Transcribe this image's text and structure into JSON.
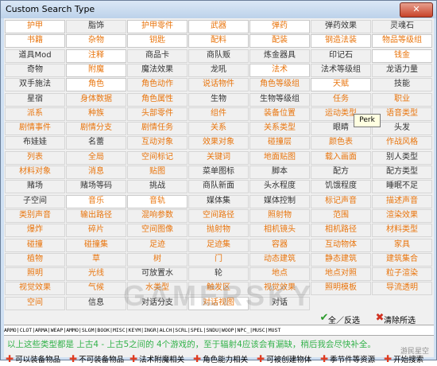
{
  "window": {
    "title": "Custom Search Type",
    "close_label": "✕"
  },
  "grid": [
    [
      {
        "t": "护甲",
        "c": "o",
        "h": 1
      },
      {
        "t": "脂饰",
        "c": "g"
      },
      {
        "t": "护甲零件",
        "c": "o",
        "h": 1
      },
      {
        "t": "武器",
        "c": "o",
        "h": 1
      },
      {
        "t": "弹药",
        "c": "o",
        "h": 1
      },
      {
        "t": "弹药效果",
        "c": "g"
      },
      {
        "t": "灵魂石",
        "c": "g"
      }
    ],
    [
      {
        "t": "书籍",
        "c": "o",
        "h": 1
      },
      {
        "t": "杂物",
        "c": "o",
        "h": 1
      },
      {
        "t": "钥匙",
        "c": "o",
        "h": 1
      },
      {
        "t": "配料",
        "c": "o",
        "h": 1
      },
      {
        "t": "配装",
        "c": "o",
        "h": 1
      },
      {
        "t": "钢造法装",
        "c": "o",
        "h": 1
      },
      {
        "t": "物品等级组",
        "c": "o",
        "h": 1
      }
    ],
    [
      {
        "t": "道具Mod",
        "c": "g"
      },
      {
        "t": "注释",
        "c": "o",
        "h": 1
      },
      {
        "t": "商品卡",
        "c": "g"
      },
      {
        "t": "商队贩",
        "c": "g"
      },
      {
        "t": "炼金器具",
        "c": "g"
      },
      {
        "t": "印记石",
        "c": "g"
      },
      {
        "t": "钱金",
        "c": "o",
        "h": 1
      }
    ],
    [
      {
        "t": "奇物",
        "c": "b"
      },
      {
        "t": "附魔",
        "c": "o",
        "h": 1
      },
      {
        "t": "魔法效果",
        "c": "g"
      },
      {
        "t": "龙吼",
        "c": "g"
      },
      {
        "t": "法术",
        "c": "o",
        "h": 1
      },
      {
        "t": "法术等级组",
        "c": "g"
      },
      {
        "t": "龙语力量",
        "c": "g"
      }
    ],
    [
      {
        "t": "双手施法",
        "c": "g"
      },
      {
        "t": "角色",
        "c": "o",
        "h": 1
      },
      {
        "t": "角色动作",
        "c": "o"
      },
      {
        "t": "说话物件",
        "c": "o"
      },
      {
        "t": "角色等级组",
        "c": "o"
      },
      {
        "t": "天赋",
        "c": "o",
        "h": 1
      },
      {
        "t": "技能",
        "c": "g"
      }
    ],
    [
      {
        "t": "星宿",
        "c": "g"
      },
      {
        "t": "身体数据",
        "c": "o"
      },
      {
        "t": "角色属性",
        "c": "o"
      },
      {
        "t": "生物",
        "c": "g"
      },
      {
        "t": "生物等级组",
        "c": "g"
      },
      {
        "t": "任务",
        "c": "o"
      },
      {
        "t": "职业",
        "c": "o"
      }
    ],
    [
      {
        "t": "派系",
        "c": "o"
      },
      {
        "t": "种族",
        "c": "o"
      },
      {
        "t": "头部零件",
        "c": "o"
      },
      {
        "t": "组件",
        "c": "o"
      },
      {
        "t": "装备位置",
        "c": "o"
      },
      {
        "t": "运动类型",
        "c": "o"
      },
      {
        "t": "语音类型",
        "c": "o"
      }
    ],
    [
      {
        "t": "剧情事件",
        "c": "o"
      },
      {
        "t": "剧情分支",
        "c": "o"
      },
      {
        "t": "剧情任务",
        "c": "o"
      },
      {
        "t": "关系",
        "c": "o"
      },
      {
        "t": "关系类型",
        "c": "o"
      },
      {
        "t": "眼睛",
        "c": "g"
      },
      {
        "t": "头发",
        "c": "g"
      }
    ],
    [
      {
        "t": "布娃娃",
        "c": "g"
      },
      {
        "t": "名蕾",
        "c": "g"
      },
      {
        "t": "互动对象",
        "c": "o"
      },
      {
        "t": "效果对象",
        "c": "o"
      },
      {
        "t": "碰撞层",
        "c": "o"
      },
      {
        "t": "颜色表",
        "c": "o"
      },
      {
        "t": "作战风格",
        "c": "o"
      }
    ],
    [
      {
        "t": "列表",
        "c": "o"
      },
      {
        "t": "全局",
        "c": "o"
      },
      {
        "t": "空间标记",
        "c": "o"
      },
      {
        "t": "关键词",
        "c": "o"
      },
      {
        "t": "地面贴图",
        "c": "o"
      },
      {
        "t": "载入画面",
        "c": "o"
      },
      {
        "t": "别人类型",
        "c": "g"
      }
    ],
    [
      {
        "t": "材料对象",
        "c": "o"
      },
      {
        "t": "消息",
        "c": "o"
      },
      {
        "t": "贴图",
        "c": "o"
      },
      {
        "t": "菜单图标",
        "c": "g"
      },
      {
        "t": "脚本",
        "c": "g"
      },
      {
        "t": "配方",
        "c": "g"
      },
      {
        "t": "配方类型",
        "c": "g"
      }
    ],
    [
      {
        "t": "赌场",
        "c": "g"
      },
      {
        "t": "赌场等码",
        "c": "g"
      },
      {
        "t": "挑战",
        "c": "g"
      },
      {
        "t": "商队新面",
        "c": "g"
      },
      {
        "t": "头水程度",
        "c": "g"
      },
      {
        "t": "饥饿程度",
        "c": "g"
      },
      {
        "t": "睡眠不足",
        "c": "g"
      }
    ],
    [
      {
        "t": "子空间",
        "c": "g"
      },
      {
        "t": "音乐",
        "c": "o",
        "h": 1
      },
      {
        "t": "音轨",
        "c": "o",
        "h": 1
      },
      {
        "t": "媒体集",
        "c": "g"
      },
      {
        "t": "媒体控制",
        "c": "g"
      },
      {
        "t": "标记声音",
        "c": "o"
      },
      {
        "t": "描述声音",
        "c": "o"
      }
    ],
    [
      {
        "t": "类别声音",
        "c": "o"
      },
      {
        "t": "输出路径",
        "c": "o"
      },
      {
        "t": "混响参数",
        "c": "o"
      },
      {
        "t": "空间路径",
        "c": "o"
      },
      {
        "t": "照射物",
        "c": "o"
      },
      {
        "t": "范围",
        "c": "o"
      },
      {
        "t": "渲染效果",
        "c": "o"
      }
    ],
    [
      {
        "t": "爆炸",
        "c": "o"
      },
      {
        "t": "碎片",
        "c": "o"
      },
      {
        "t": "空间图像",
        "c": "o"
      },
      {
        "t": "抛射物",
        "c": "o"
      },
      {
        "t": "相机镜头",
        "c": "o"
      },
      {
        "t": "相机路径",
        "c": "o"
      },
      {
        "t": "材料类型",
        "c": "o"
      }
    ],
    [
      {
        "t": "碰撞",
        "c": "o"
      },
      {
        "t": "碰撞集",
        "c": "o"
      },
      {
        "t": "足迹",
        "c": "o"
      },
      {
        "t": "足迹集",
        "c": "o"
      },
      {
        "t": "容器",
        "c": "o"
      },
      {
        "t": "互动物体",
        "c": "o"
      },
      {
        "t": "家具",
        "c": "o"
      }
    ],
    [
      {
        "t": "植物",
        "c": "o"
      },
      {
        "t": "草",
        "c": "o"
      },
      {
        "t": "树",
        "c": "o"
      },
      {
        "t": "门",
        "c": "o"
      },
      {
        "t": "动态建筑",
        "c": "o"
      },
      {
        "t": "静态建筑",
        "c": "o"
      },
      {
        "t": "建筑集合",
        "c": "o"
      }
    ],
    [
      {
        "t": "照明",
        "c": "o"
      },
      {
        "t": "光线",
        "c": "o"
      },
      {
        "t": "可放置水",
        "c": "g"
      },
      {
        "t": "轮",
        "c": "g"
      },
      {
        "t": "地点",
        "c": "o"
      },
      {
        "t": "地点对照",
        "c": "o"
      },
      {
        "t": "粒子渲染",
        "c": "o"
      }
    ],
    [
      {
        "t": "视觉效果",
        "c": "o"
      },
      {
        "t": "气候",
        "c": "o"
      },
      {
        "t": "水类型",
        "c": "o"
      },
      {
        "t": "触发区",
        "c": "o"
      },
      {
        "t": "视觉效果",
        "c": "o"
      },
      {
        "t": "照明模板",
        "c": "o"
      },
      {
        "t": "导流透明",
        "c": "o"
      }
    ],
    [
      {
        "t": "空间",
        "c": "o"
      },
      {
        "t": "信息",
        "c": "g"
      },
      {
        "t": "对话分支",
        "c": "g"
      },
      {
        "t": "对话视图",
        "c": "o",
        "h": 1
      },
      {
        "t": "对话",
        "c": "g"
      }
    ]
  ],
  "controls": {
    "select_all": "全／反选",
    "clear_all": "清除所选",
    "select_all_icon": "check-icon",
    "clear_all_icon": "close-icon"
  },
  "codes": "ARMO|CLOT|ARMA|WEAP|AMMO|SLGM|BOOK|MISC|KEYM|INGR|ALCH|SCRL|SPEL|SNDU|WOOP|NPC_|MUSC|MUST",
  "message": "以上这些类型都是 上古4 - 上古5之间的 4个游戏的，至于辐射4应该会有漏缺，稍后我会尽快补全。",
  "tooltip": "Perk",
  "bottom_buttons": [
    {
      "label": "可以装备物品"
    },
    {
      "label": "不可装备物品"
    },
    {
      "label": "法术附魔相关"
    },
    {
      "label": "角色能力相关"
    },
    {
      "label": "可被创建物体"
    },
    {
      "label": "季节件等资源"
    },
    {
      "label": "开始搜索"
    }
  ],
  "watermark": "GAMERSKY",
  "watermark2": "游民星空",
  "colors": {
    "accent_orange": "#e8740c",
    "message_green": "#33b24a",
    "plus_red": "#e03a1e"
  }
}
